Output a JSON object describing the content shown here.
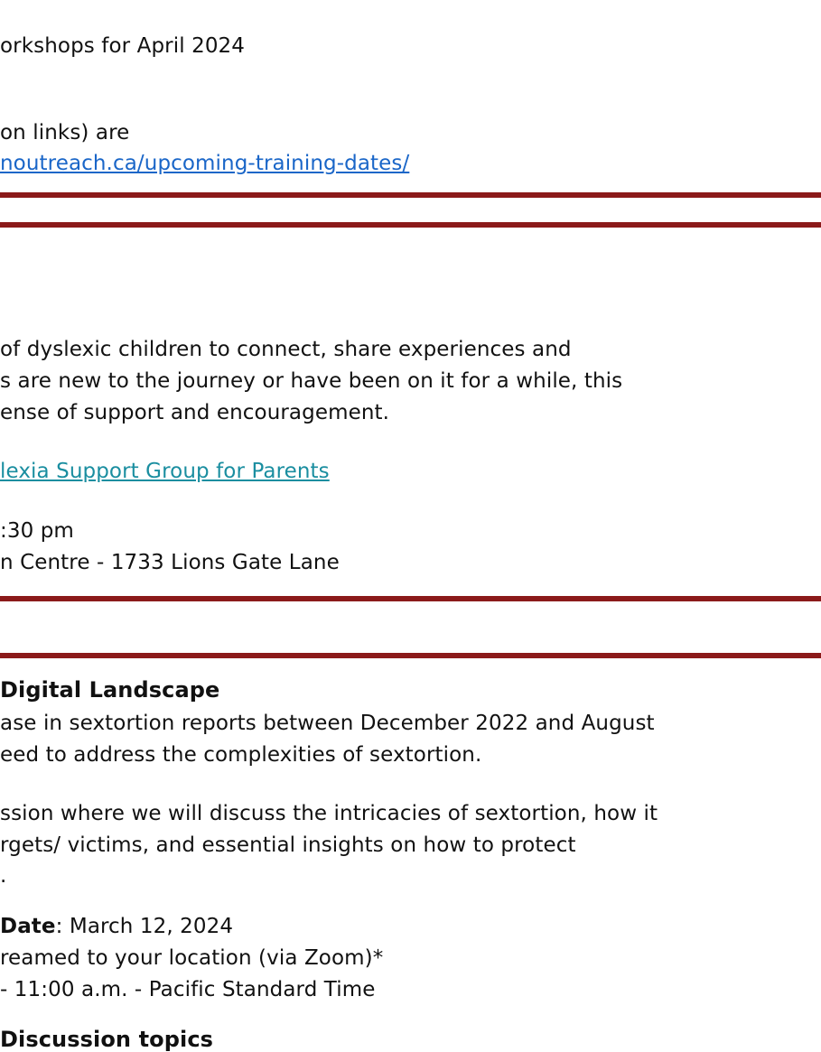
{
  "section1": {
    "line1": "orkshops for April 2024",
    "line2": "on links) are",
    "link": "noutreach.ca/upcoming-training-dates/"
  },
  "section2": {
    "line1": "of dyslexic children to connect, share experiences and",
    "line2": "s are new to the journey or have been on it for a while, this",
    "line3": "ense of support and encouragement.",
    "link": "lexia Support Group for Parents",
    "time": ":30 pm",
    "location": "n Centre - 1733 Lions Gate Lane"
  },
  "section3": {
    "title": "Digital Landscape",
    "p1_line1": "ase in sextortion reports between December 2022 and August",
    "p1_line2": "eed to address the complexities of sextortion.",
    "p2_line1": "ssion where we will discuss the intricacies of sextortion, how it",
    "p2_line2": "rgets/ victims, and essential insights on how to protect",
    "p2_line3": ".",
    "date_label": "Date",
    "date_value": ": March 12, 2024",
    "streamed": "reamed to your location (via Zoom)*",
    "time": " - 11:00 a.m. - Pacific Standard Time",
    "partial_heading": "Discussion topics"
  },
  "colors": {
    "rule": "#8b1a1a",
    "link_blue": "#1a66c8",
    "link_teal": "#1a8ea0"
  }
}
